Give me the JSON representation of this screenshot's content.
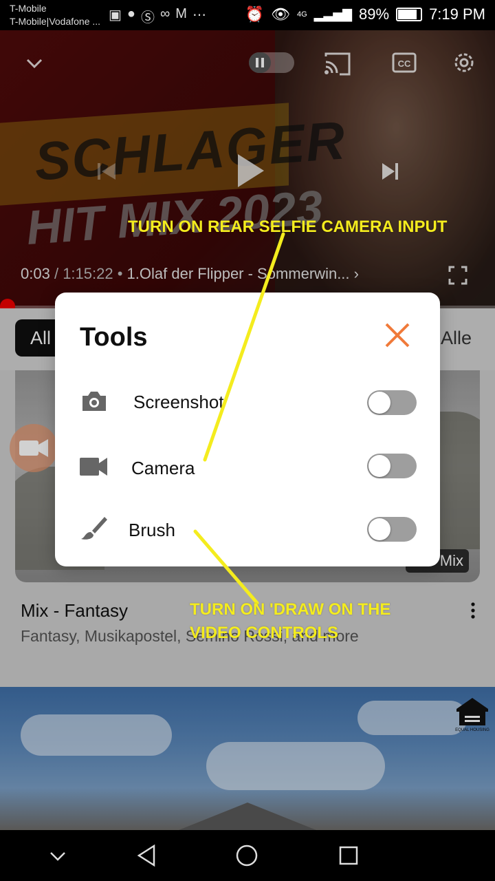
{
  "status_bar": {
    "carrier_line1": "T-Mobile",
    "carrier_line2": "T-Mobile|Vodafone ...",
    "network": "4G",
    "battery": "89%",
    "time": "7:19 PM"
  },
  "player": {
    "video_title_line1": "SCHLAGER",
    "video_title_line2": "HIT MIX 2023",
    "time_current": "0:03",
    "time_total": "1:15:22",
    "chapter": "1.Olaf der Flipper - Sommerwin...",
    "progress_fraction": 0.0
  },
  "chips": {
    "all": "All",
    "fuer_alle": "ir Alle"
  },
  "video_card": {
    "badge": "Mix",
    "title": "Mix - Fantasy",
    "subtitle": "Fantasy, Musikapostel, Semino Rossi, and more"
  },
  "tools_dialog": {
    "title": "Tools",
    "rows": [
      {
        "label": "Screenshot",
        "icon": "camera-icon",
        "enabled": false
      },
      {
        "label": "Camera",
        "icon": "video-camera-icon",
        "enabled": false
      },
      {
        "label": "Brush",
        "icon": "brush-icon",
        "enabled": false
      }
    ]
  },
  "annotations": {
    "top": "TURN ON REAR SELFIE CAMERA INPUT",
    "bottom_line1": "TURN ON 'DRAW ON THE",
    "bottom_line2": "VIDEO CONTROLS"
  },
  "colors": {
    "annotation": "#f4ec1e",
    "close_x": "#f07a3a",
    "progress": "#ff0000"
  }
}
